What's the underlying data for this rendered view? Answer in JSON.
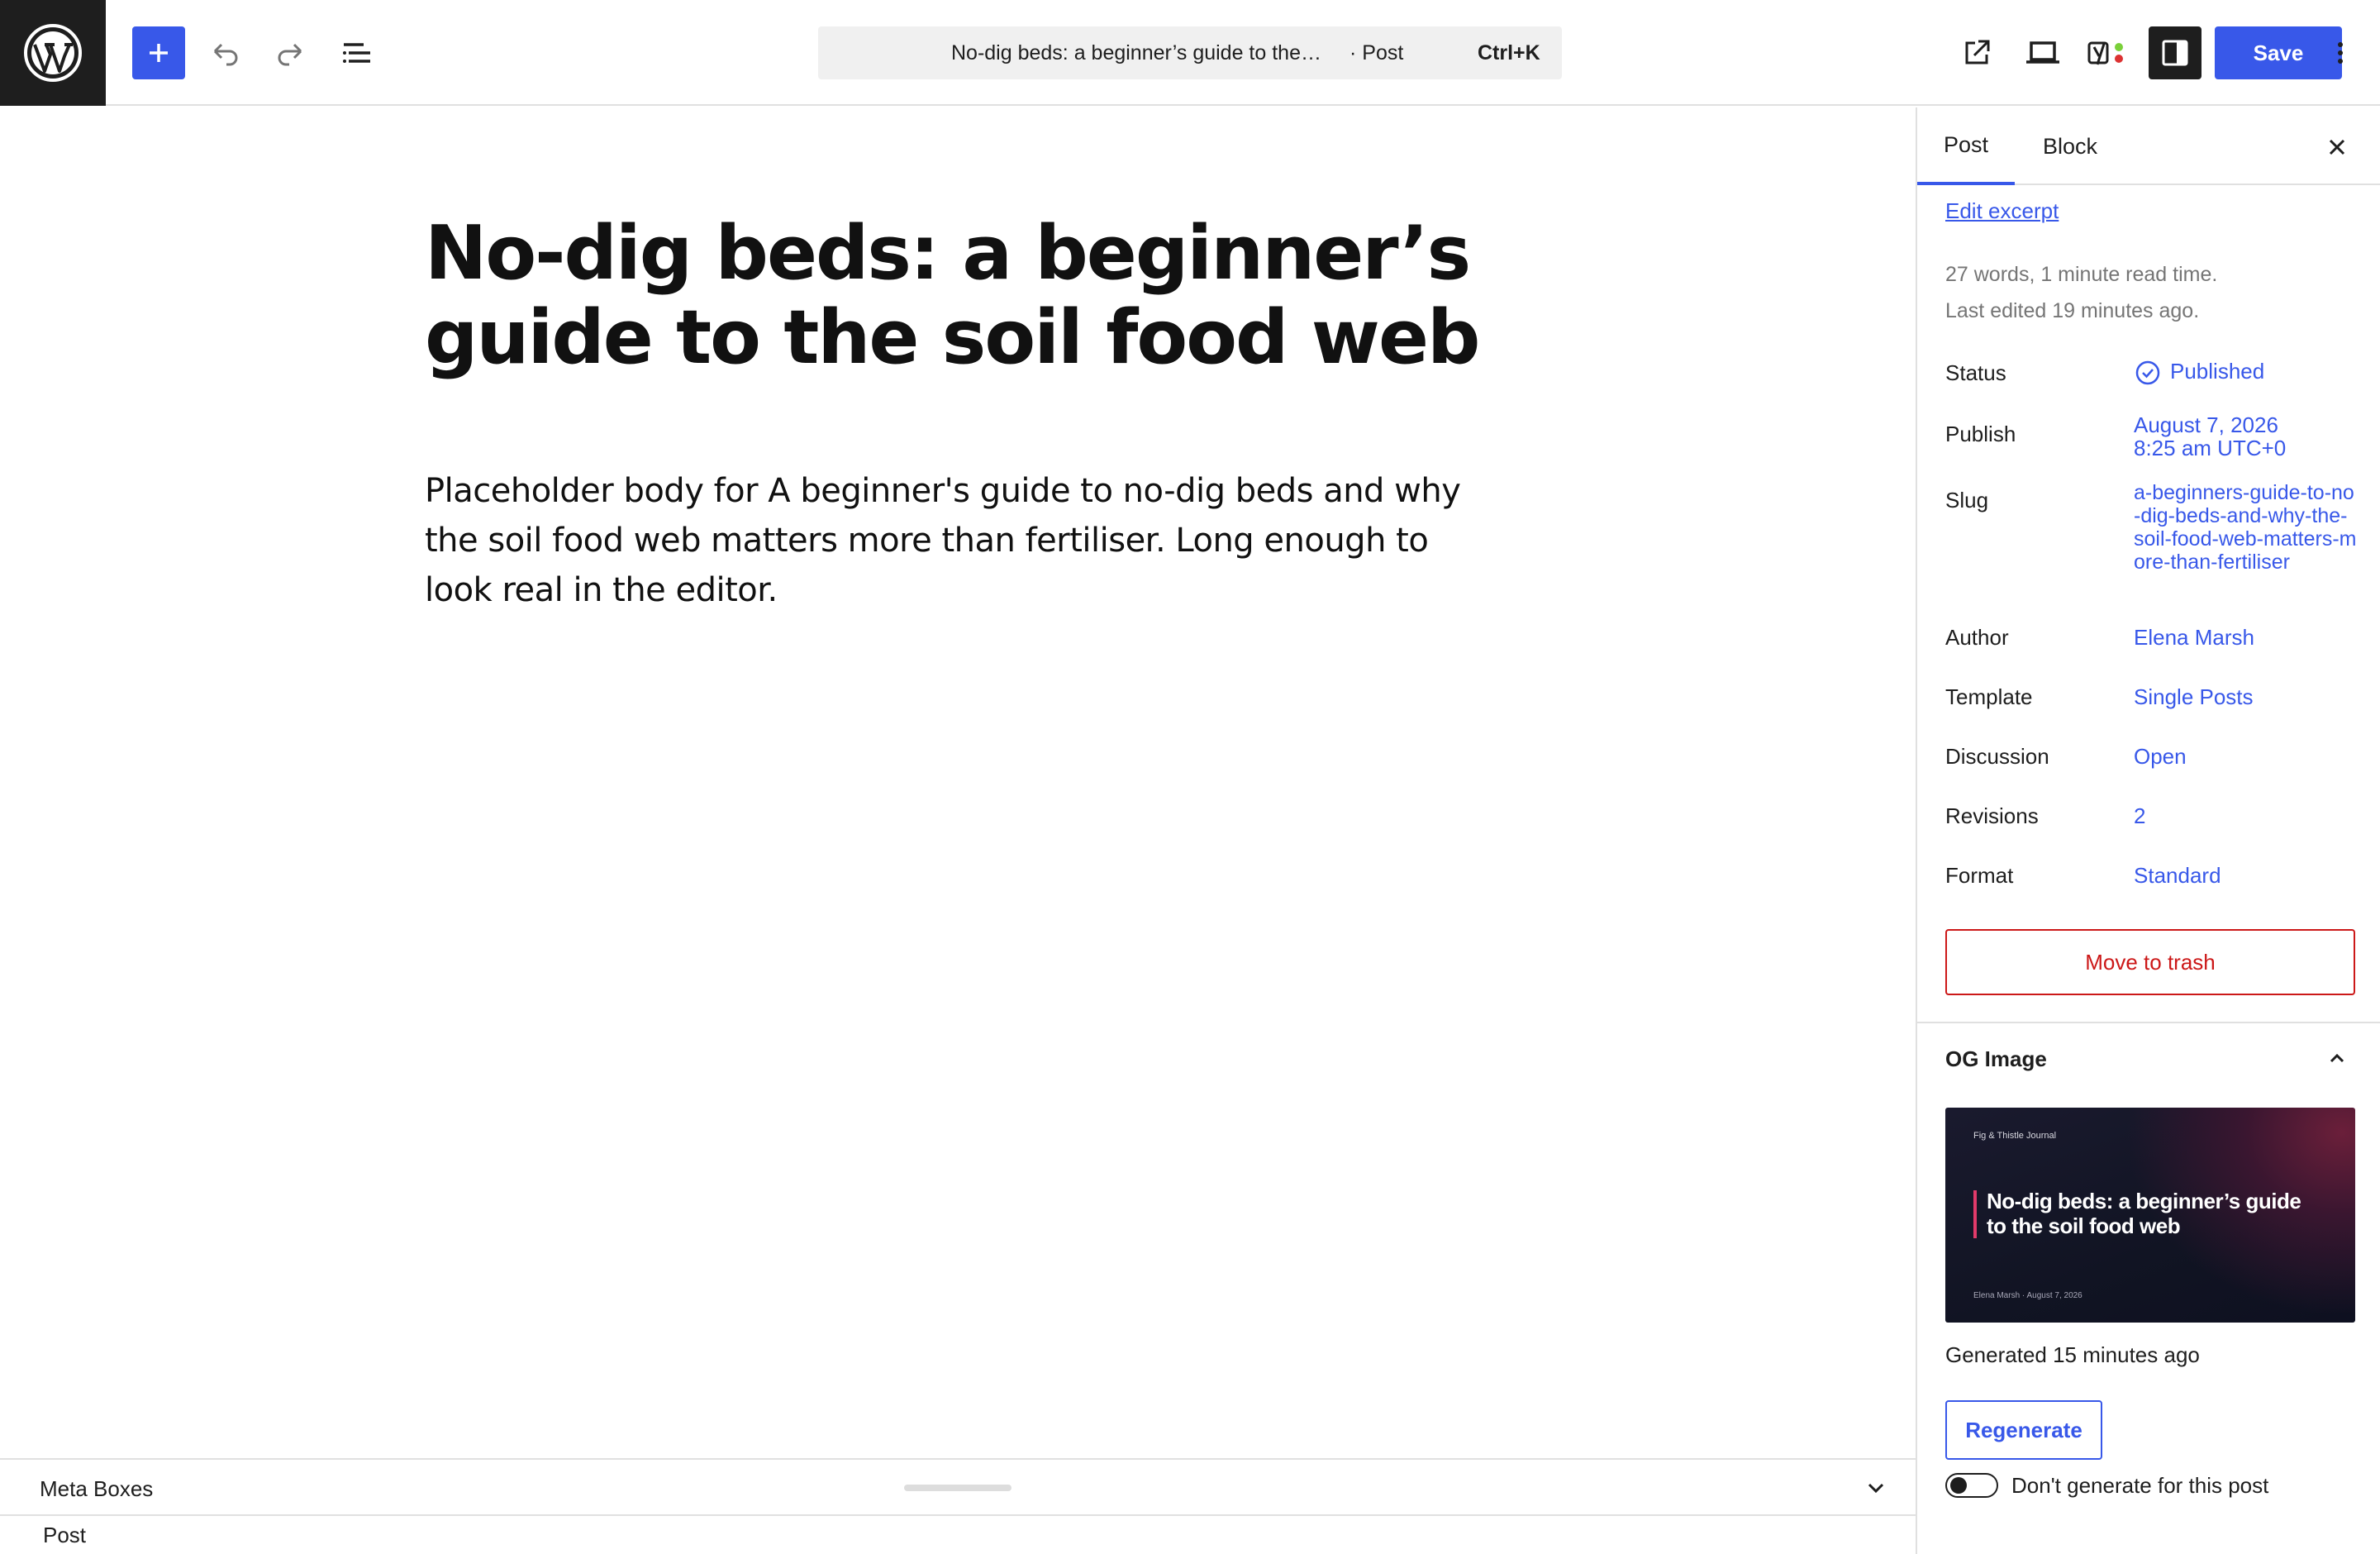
{
  "toolbar": {
    "command_title": "No-dig beds: a beginner’s guide to the…",
    "command_post_type": "· Post",
    "command_shortcut": "Ctrl+K",
    "save_label": "Save",
    "accent_color": "#3858e9"
  },
  "editor": {
    "title": "No-dig beds: a beginner’s guide to the soil food web",
    "body": "Placeholder body for A beginner's guide to no-dig beds and why the soil food web matters more than fertiliser. Long enough to look real in the editor."
  },
  "sidebar": {
    "tabs": [
      {
        "label": "Post",
        "active": true
      },
      {
        "label": "Block",
        "active": false
      }
    ],
    "edit_excerpt": "Edit excerpt",
    "word_count": "27 words, 1 minute read time.",
    "last_edited": "Last edited 19 minutes ago.",
    "rows": {
      "status": {
        "label": "Status",
        "value": "Published"
      },
      "publish": {
        "label": "Publish",
        "date": "August 7, 2026",
        "time": "8:25 am UTC+0"
      },
      "slug": {
        "label": "Slug",
        "value": "a-beginners-guide-to-no-dig-beds-and-why-the-soil-food-web-matters-more-than-fertiliser"
      },
      "author": {
        "label": "Author",
        "value": "Elena Marsh"
      },
      "template": {
        "label": "Template",
        "value": "Single Posts"
      },
      "discussion": {
        "label": "Discussion",
        "value": "Open"
      },
      "revisions": {
        "label": "Revisions",
        "value": "2"
      },
      "format": {
        "label": "Format",
        "value": "Standard"
      }
    },
    "trash_label": "Move to trash",
    "og": {
      "heading": "OG Image",
      "image_brand": "Fig & Thistle Journal",
      "image_title": "No-dig beds: a beginner’s guide to the soil food web",
      "image_meta": "Elena Marsh  ·  August 7, 2026",
      "generated": "Generated 15 minutes ago",
      "regenerate_label": "Regenerate",
      "toggle_label": "Don't generate for this post",
      "toggle_on": false
    }
  },
  "metabox": {
    "label": "Meta Boxes"
  },
  "footer": {
    "breadcrumb": "Post"
  }
}
